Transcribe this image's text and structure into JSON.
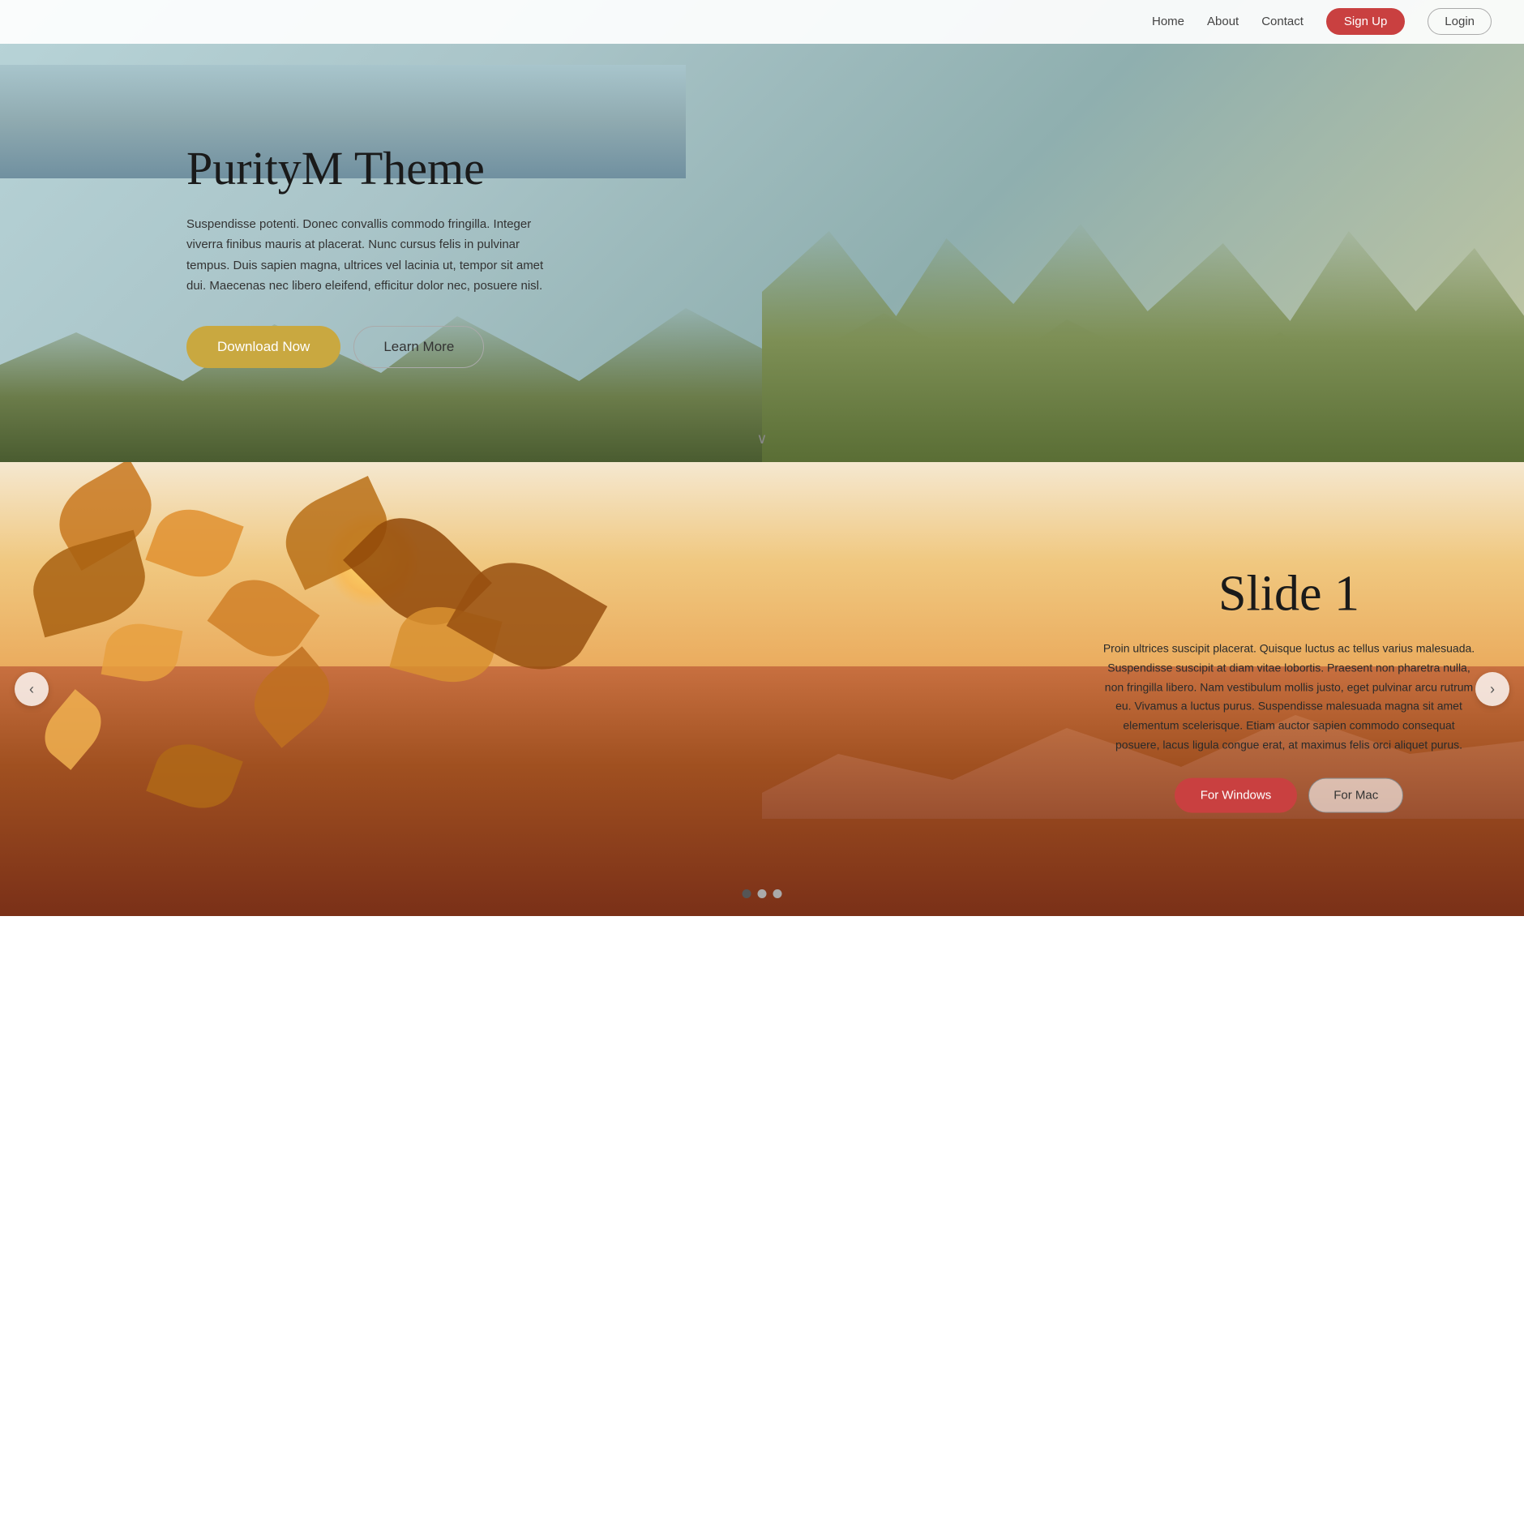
{
  "navbar": {
    "links": [
      {
        "id": "home",
        "label": "Home"
      },
      {
        "id": "about",
        "label": "About"
      },
      {
        "id": "contact",
        "label": "Contact"
      }
    ],
    "signup_label": "Sign Up",
    "login_label": "Login"
  },
  "hero": {
    "title": "PurityM Theme",
    "description": "Suspendisse potenti. Donec convallis commodo fringilla. Integer viverra finibus mauris at placerat. Nunc cursus felis in pulvinar tempus. Duis sapien magna, ultrices vel lacinia ut, tempor sit amet dui. Maecenas nec libero eleifend, efficitur dolor nec, posuere nisl.",
    "download_label": "Download Now",
    "learn_label": "Learn More",
    "scroll_hint": "∨"
  },
  "slider": {
    "slide_title": "Slide 1",
    "slide_description": "Proin ultrices suscipit placerat. Quisque luctus ac tellus varius malesuada. Suspendisse suscipit at diam vitae lobortis. Praesent non pharetra nulla, non fringilla libero. Nam vestibulum mollis justo, eget pulvinar arcu rutrum eu. Vivamus a luctus purus. Suspendisse malesuada magna sit amet elementum scelerisque. Etiam auctor sapien commodo consequat posuere, lacus ligula congue erat, at maximus felis orci aliquet purus.",
    "windows_label": "For Windows",
    "mac_label": "For Mac",
    "arrow_left": "‹",
    "arrow_right": "›",
    "dots": [
      {
        "id": 1,
        "active": true
      },
      {
        "id": 2,
        "active": false
      },
      {
        "id": 3,
        "active": false
      }
    ]
  }
}
